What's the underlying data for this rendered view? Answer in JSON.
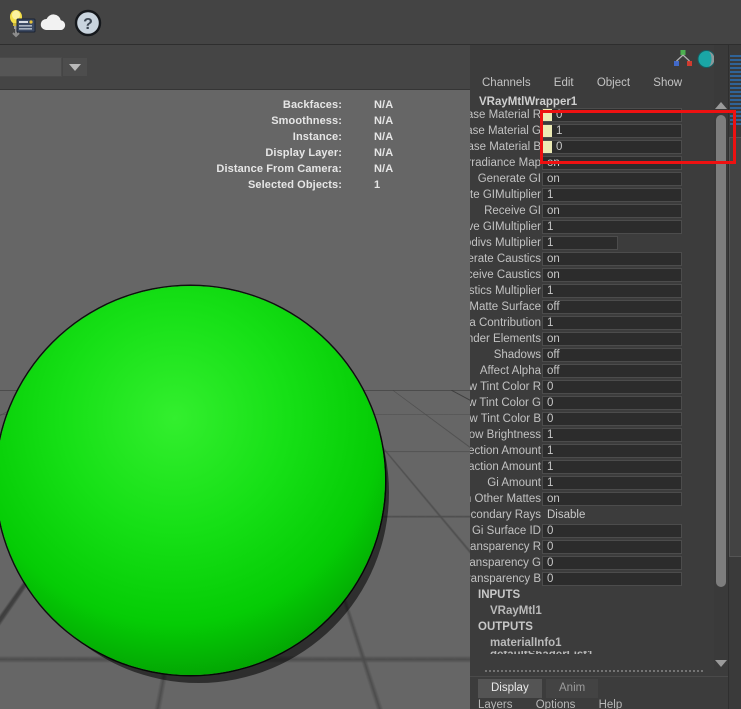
{
  "toolbar": {
    "icons": [
      {
        "name": "hypershade-icon",
        "label": "Hypershade"
      },
      {
        "name": "cloud-icon",
        "label": "Cloud"
      },
      {
        "name": "help-icon",
        "label": "Help"
      }
    ]
  },
  "viewport": {
    "search_value": "",
    "search_placeholder": "",
    "dropdown_label": "▼",
    "hud": [
      {
        "label": "Backfaces:",
        "value": "N/A"
      },
      {
        "label": "Smoothness:",
        "value": "N/A"
      },
      {
        "label": "Instance:",
        "value": "N/A"
      },
      {
        "label": "Display Layer:",
        "value": "N/A"
      },
      {
        "label": "Distance From Camera:",
        "value": "N/A"
      },
      {
        "label": "Selected Objects:",
        "value": "1"
      }
    ],
    "object": {
      "shape": "sphere",
      "material_color": "#14dd14"
    }
  },
  "attribute_editor": {
    "tool_icons": [
      {
        "name": "node-hierarchy-icon"
      },
      {
        "name": "render-sphere-icon"
      },
      {
        "name": "graph-editor-icon"
      }
    ],
    "menus": [
      "Channels",
      "Edit",
      "Object",
      "Show"
    ],
    "node_title": "VRayMtlWrapper1",
    "attributes": [
      {
        "label": "Base Material R",
        "value": "0",
        "style": "keyed",
        "highlighted": true
      },
      {
        "label": "Base Material G",
        "value": "1",
        "style": "keyed",
        "highlighted": true
      },
      {
        "label": "Base Material B",
        "value": "0",
        "style": "keyed",
        "highlighted": true
      },
      {
        "label": "Use Irradiance Map",
        "value": "on",
        "style": "normal"
      },
      {
        "label": "Generate GI",
        "value": "on",
        "style": "normal"
      },
      {
        "label": "Generate GIMultiplier",
        "value": "1",
        "style": "normal"
      },
      {
        "label": "Receive GI",
        "value": "on",
        "style": "normal"
      },
      {
        "label": "Receive GIMultiplier",
        "value": "1",
        "style": "normal"
      },
      {
        "label": "Gi Subdivs Multiplier",
        "value": "1",
        "style": "short"
      },
      {
        "label": "Generate Caustics",
        "value": "on",
        "style": "normal"
      },
      {
        "label": "Receive Caustics",
        "value": "on",
        "style": "normal"
      },
      {
        "label": "Caustics Multiplier",
        "value": "1",
        "style": "normal"
      },
      {
        "label": "Matte Surface",
        "value": "off",
        "style": "normal"
      },
      {
        "label": "Alpha Contribution",
        "value": "1",
        "style": "normal"
      },
      {
        "label": "Generate Render Elements",
        "value": "on",
        "style": "normal"
      },
      {
        "label": "Shadows",
        "value": "off",
        "style": "normal"
      },
      {
        "label": "Affect Alpha",
        "value": "off",
        "style": "normal"
      },
      {
        "label": "Shadow Tint Color R",
        "value": "0",
        "style": "normal"
      },
      {
        "label": "Shadow Tint Color G",
        "value": "0",
        "style": "normal"
      },
      {
        "label": "Shadow Tint Color B",
        "value": "0",
        "style": "normal"
      },
      {
        "label": "Shadow Brightness",
        "value": "1",
        "style": "normal"
      },
      {
        "label": "Reflection Amount",
        "value": "1",
        "style": "normal"
      },
      {
        "label": "Refraction Amount",
        "value": "1",
        "style": "normal"
      },
      {
        "label": "Gi Amount",
        "value": "1",
        "style": "normal"
      },
      {
        "label": "No GIOn Other Mattes",
        "value": "on",
        "style": "normal"
      },
      {
        "label": "Matte For Secondary Rays",
        "value": "Disable",
        "style": "plain"
      },
      {
        "label": "Gi Surface ID",
        "value": "0",
        "style": "normal"
      },
      {
        "label": "Out Transparency R",
        "value": "0",
        "style": "normal"
      },
      {
        "label": "Out Transparency G",
        "value": "0",
        "style": "normal"
      },
      {
        "label": "Out Transparency B",
        "value": "0",
        "style": "normal"
      }
    ],
    "sections": [
      {
        "heading": "INPUTS",
        "items": [
          "VRayMtl1"
        ]
      },
      {
        "heading": "OUTPUTS",
        "items": [
          "materialInfo1",
          "defaultShaderList1"
        ]
      }
    ],
    "scrollbar": {
      "up_label": "▲",
      "down_label": "▼"
    }
  },
  "bottom_panel": {
    "tabs": [
      {
        "label": "Display",
        "active": true
      },
      {
        "label": "Anim",
        "active": false
      }
    ],
    "menus": [
      "Layers",
      "Options",
      "Help"
    ]
  },
  "annotation": {
    "highlight_color": "#ee1111",
    "keyed_marker_color": "#eceab4"
  }
}
